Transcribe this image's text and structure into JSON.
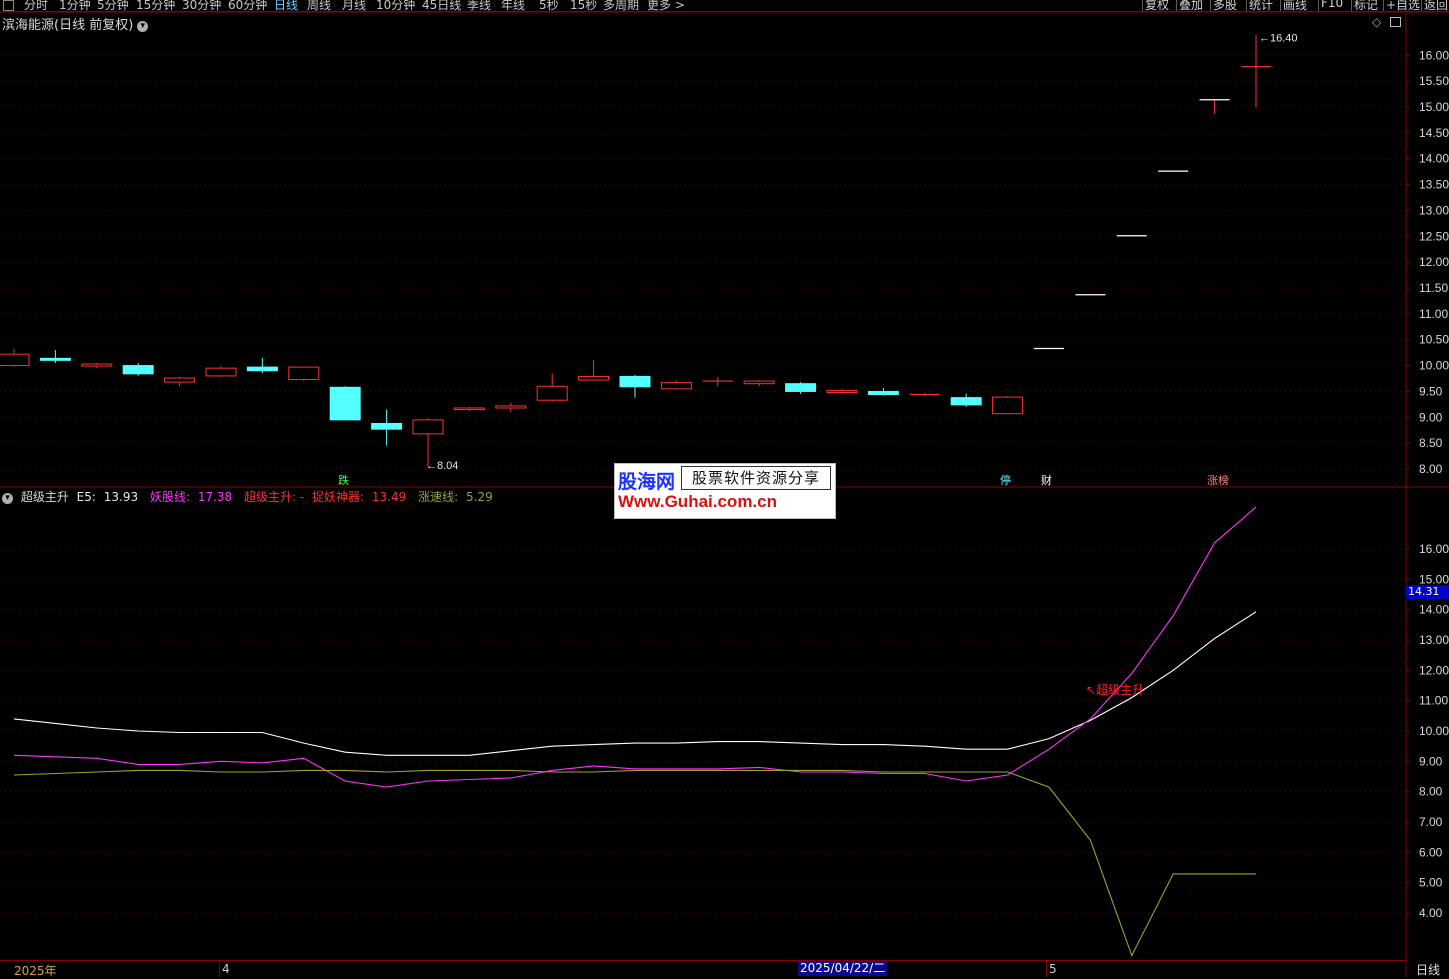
{
  "toolbar": {
    "tabs": [
      "分时",
      "1分钟",
      "5分钟",
      "15分钟",
      "30分钟",
      "60分钟",
      "日线",
      "周线",
      "月线",
      "10分钟",
      "45日线",
      "季线",
      "年线",
      "5秒",
      "15秒",
      "多周期",
      "更多 >"
    ],
    "active": "日线",
    "right_buttons": [
      "复权",
      "叠加",
      "多股",
      "统计",
      "画线",
      "F10",
      "标记",
      "+自选",
      "返回"
    ]
  },
  "chart_title": "滨海能源(日线 前复权)",
  "main_axis_ticks": [
    "16.00",
    "15.50",
    "15.00",
    "14.50",
    "14.00",
    "13.50",
    "13.00",
    "12.50",
    "12.00",
    "11.50",
    "11.00",
    "10.50",
    "10.00",
    "9.50",
    "9.00",
    "8.50",
    "8.00"
  ],
  "annotations": {
    "high_label": "16.40",
    "low_label": "8.04",
    "pins": [
      "跌",
      "停",
      "财",
      "涨榜"
    ]
  },
  "indicator": {
    "name": "超级主升",
    "e5_label": "E5:",
    "e5_value": "13.93",
    "yao_label": "妖股线:",
    "yao_value": "17.38",
    "zhu_label": "超级主升: -",
    "shen_label": "捉妖神器:",
    "shen_value": "13.49",
    "zs_label": "涨速线:",
    "zs_value": "5.29",
    "signal_label": "超级主升",
    "axis_ticks": [
      "16.00",
      "15.00",
      "14.00",
      "13.00",
      "12.00",
      "11.00",
      "10.00",
      "9.00",
      "8.00",
      "7.00",
      "6.00",
      "5.00",
      "4.00"
    ],
    "current_tag": "14.31"
  },
  "time_axis": {
    "labels": [
      "2025年",
      "4",
      "5"
    ],
    "highlight": "2025/04/22/二",
    "period": "日线"
  },
  "watermark": {
    "brand": "股海网",
    "slogan": "股票软件资源分享",
    "url": "Www.Guhai.com.cn"
  },
  "colors": {
    "up": "#ff3030",
    "down": "#54ffff",
    "white_line": "#ffffff",
    "magenta_line": "#ff33ff",
    "olive_line": "#a0a030",
    "grid": "#8a0000"
  },
  "chart_data": [
    {
      "type": "candlestick",
      "title": "滨海能源(日线 前复权)",
      "ylim": [
        7.8,
        16.5
      ],
      "candles": [
        {
          "o": 10.0,
          "h": 10.32,
          "l": 9.98,
          "c": 10.22,
          "dir": "up"
        },
        {
          "o": 10.14,
          "h": 10.3,
          "l": 10.05,
          "c": 10.12,
          "dir": "down"
        },
        {
          "o": 9.99,
          "h": 10.05,
          "l": 9.95,
          "c": 10.03,
          "dir": "up"
        },
        {
          "o": 10.0,
          "h": 10.05,
          "l": 9.8,
          "c": 9.84,
          "dir": "down"
        },
        {
          "o": 9.68,
          "h": 9.78,
          "l": 9.6,
          "c": 9.76,
          "dir": "up"
        },
        {
          "o": 9.8,
          "h": 9.98,
          "l": 9.78,
          "c": 9.95,
          "dir": "up"
        },
        {
          "o": 9.97,
          "h": 10.15,
          "l": 9.85,
          "c": 9.9,
          "dir": "down"
        },
        {
          "o": 9.73,
          "h": 9.98,
          "l": 9.7,
          "c": 9.97,
          "dir": "up"
        },
        {
          "o": 9.58,
          "h": 9.6,
          "l": 8.95,
          "c": 8.95,
          "dir": "down"
        },
        {
          "o": 8.88,
          "h": 9.15,
          "l": 8.45,
          "c": 8.77,
          "dir": "down"
        },
        {
          "o": 8.68,
          "h": 8.98,
          "l": 8.04,
          "c": 8.95,
          "dir": "up"
        },
        {
          "o": 9.15,
          "h": 9.2,
          "l": 9.12,
          "c": 9.18,
          "dir": "up"
        },
        {
          "o": 9.18,
          "h": 9.28,
          "l": 9.1,
          "c": 9.22,
          "dir": "up"
        },
        {
          "o": 9.33,
          "h": 9.85,
          "l": 9.3,
          "c": 9.6,
          "dir": "up"
        },
        {
          "o": 9.72,
          "h": 10.1,
          "l": 9.7,
          "c": 9.79,
          "dir": "up"
        },
        {
          "o": 9.79,
          "h": 9.82,
          "l": 9.38,
          "c": 9.59,
          "dir": "down"
        },
        {
          "o": 9.55,
          "h": 9.71,
          "l": 9.54,
          "c": 9.67,
          "dir": "up"
        },
        {
          "o": 9.68,
          "h": 9.78,
          "l": 9.6,
          "c": 9.7,
          "dir": "up"
        },
        {
          "o": 9.65,
          "h": 9.72,
          "l": 9.6,
          "c": 9.7,
          "dir": "up"
        },
        {
          "o": 9.65,
          "h": 9.68,
          "l": 9.45,
          "c": 9.5,
          "dir": "down"
        },
        {
          "o": 9.48,
          "h": 9.55,
          "l": 9.44,
          "c": 9.52,
          "dir": "up"
        },
        {
          "o": 9.5,
          "h": 9.57,
          "l": 9.42,
          "c": 9.44,
          "dir": "down"
        },
        {
          "o": 9.44,
          "h": 9.47,
          "l": 9.41,
          "c": 9.44,
          "dir": "up"
        },
        {
          "o": 9.38,
          "h": 9.46,
          "l": 9.2,
          "c": 9.24,
          "dir": "down"
        },
        {
          "o": 9.07,
          "h": 9.41,
          "l": 9.07,
          "c": 9.39,
          "dir": "up"
        },
        {
          "o": 10.33,
          "h": 10.33,
          "l": 10.33,
          "c": 10.33,
          "dir": "up"
        },
        {
          "o": 11.37,
          "h": 11.37,
          "l": 11.37,
          "c": 11.37,
          "dir": "up"
        },
        {
          "o": 12.51,
          "h": 12.51,
          "l": 12.51,
          "c": 12.51,
          "dir": "up"
        },
        {
          "o": 13.76,
          "h": 13.76,
          "l": 13.76,
          "c": 13.76,
          "dir": "up"
        },
        {
          "o": 15.14,
          "h": 15.14,
          "l": 14.87,
          "c": 15.14,
          "dir": "up"
        },
        {
          "o": 15.78,
          "h": 16.4,
          "l": 15.0,
          "c": 15.78,
          "dir": "up"
        }
      ]
    },
    {
      "type": "line",
      "title": "超级主升",
      "ylim": [
        3.3,
        17.5
      ],
      "series": [
        {
          "name": "E5",
          "values": [
            10.4,
            10.25,
            10.1,
            10.0,
            9.95,
            9.95,
            9.95,
            9.6,
            9.3,
            9.2,
            9.2,
            9.2,
            9.35,
            9.5,
            9.55,
            9.6,
            9.6,
            9.65,
            9.65,
            9.6,
            9.55,
            9.55,
            9.5,
            9.4,
            9.4,
            9.75,
            10.35,
            11.1,
            12.0,
            13.05,
            13.93
          ]
        },
        {
          "name": "妖股线",
          "values": [
            9.2,
            9.15,
            9.1,
            8.9,
            8.9,
            9.0,
            8.95,
            9.1,
            8.35,
            8.15,
            8.35,
            8.4,
            8.45,
            8.7,
            8.85,
            8.75,
            8.75,
            8.75,
            8.8,
            8.65,
            8.65,
            8.6,
            8.6,
            8.35,
            8.55,
            9.4,
            10.4,
            11.9,
            13.8,
            16.2,
            17.38
          ]
        },
        {
          "name": "涨速线",
          "values": [
            8.55,
            8.6,
            8.65,
            8.7,
            8.7,
            8.65,
            8.65,
            8.7,
            8.7,
            8.65,
            8.7,
            8.7,
            8.7,
            8.65,
            8.65,
            8.7,
            8.7,
            8.7,
            8.7,
            8.7,
            8.7,
            8.65,
            8.65,
            8.65,
            8.65,
            8.15,
            6.4,
            2.6,
            5.29,
            5.29,
            5.29
          ]
        }
      ]
    }
  ]
}
